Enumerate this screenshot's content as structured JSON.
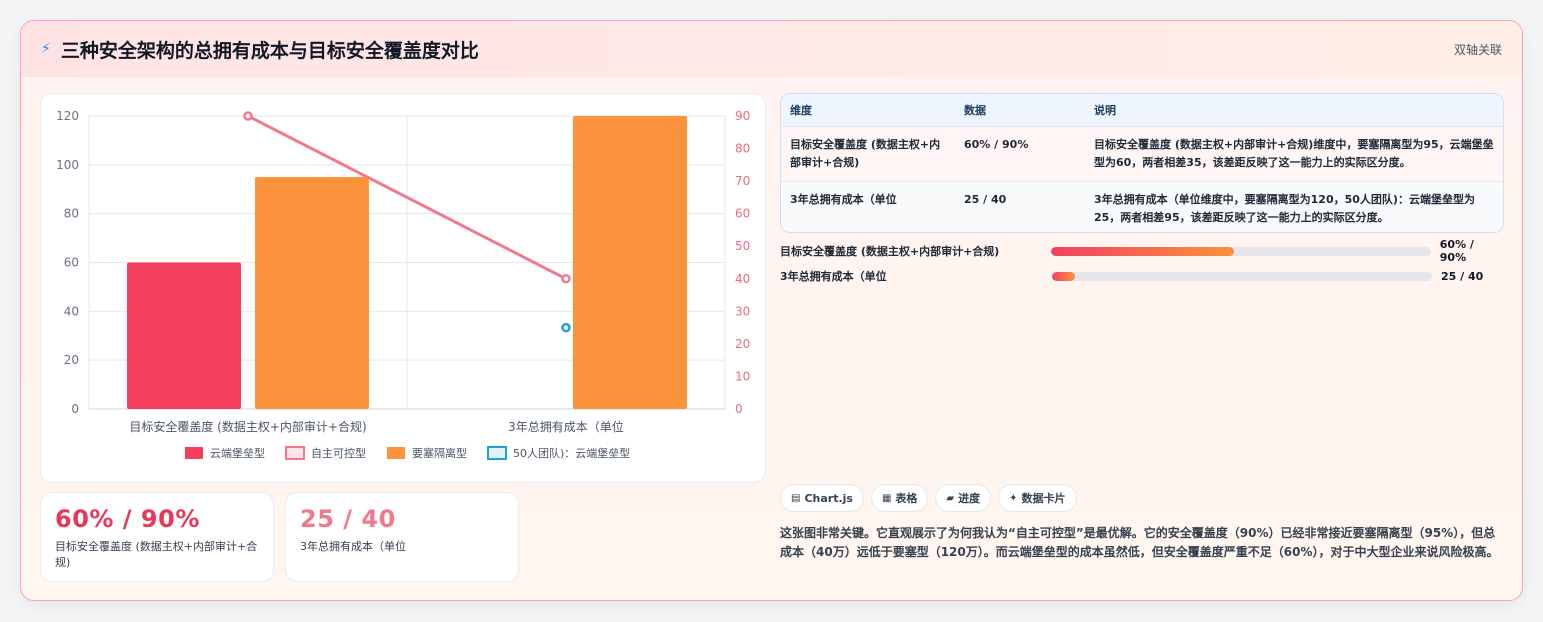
{
  "header": {
    "title": "三种安全架构的总拥有成本与目标安全覆盖度对比",
    "tag": "双轴关联"
  },
  "colors": {
    "red": "#f43f5e",
    "orange": "#fb923c",
    "pink": "#f07a8c",
    "blue": "#1da2d8"
  },
  "chart_data": {
    "type": "bar",
    "categories": [
      "目标安全覆盖度 (数据主权+内部审计+合规)",
      "3年总拥有成本（单位"
    ],
    "series": [
      {
        "name": "云端堡垒型",
        "type": "bar",
        "axis": "left",
        "values": [
          60,
          null
        ],
        "color": "#f43f5e"
      },
      {
        "name": "自主可控型",
        "type": "line",
        "axis": "right",
        "values": [
          90,
          40
        ],
        "color": "#f07a8c"
      },
      {
        "name": "要塞隔离型",
        "type": "bar",
        "axis": "left",
        "values": [
          95,
          120
        ],
        "color": "#fb923c"
      },
      {
        "name": "50人团队)：云端堡垒型",
        "type": "line",
        "axis": "right",
        "values": [
          null,
          25
        ],
        "color": "#1da2d8"
      }
    ],
    "ylim": [
      0,
      120
    ],
    "yticks": [
      0,
      20,
      40,
      60,
      80,
      100,
      120
    ],
    "y2lim": [
      0,
      90
    ],
    "y2ticks": [
      0,
      10,
      20,
      30,
      40,
      50,
      60,
      70,
      80,
      90
    ],
    "grid": true,
    "legend": "bottom"
  },
  "stats": [
    {
      "value": "60% / 90%",
      "label": "目标安全覆盖度 (数据主权+内部审计+合规)",
      "color": "#e8385a"
    },
    {
      "value": "25 / 40",
      "label": "3年总拥有成本（单位",
      "color": "#f07a8c"
    }
  ],
  "table": {
    "headers": [
      "维度",
      "数据",
      "说明"
    ],
    "rows": [
      [
        "目标安全覆盖度 (数据主权+内部审计+合规)",
        "60% / 90%",
        "目标安全覆盖度 (数据主权+内部审计+合规)维度中，要塞隔离型为95，云端堡垒型为60，两者相差35，该差距反映了这一能力上的实际区分度。"
      ],
      [
        "3年总拥有成本（单位",
        "25 / 40",
        "3年总拥有成本（单位维度中，要塞隔离型为120，50人团队)：云端堡垒型为25，两者相差95，该差距反映了这一能力上的实际区分度。"
      ]
    ]
  },
  "progress": [
    {
      "label": "目标安全覆盖度 (数据主权+内部审计+合规)",
      "value_text": "60% / 90%",
      "fraction": 0.48
    },
    {
      "label": "3年总拥有成本（单位",
      "value_text": "25 / 40",
      "fraction": 0.06
    }
  ],
  "chips": [
    {
      "icon": "▤",
      "label": "Chart.js"
    },
    {
      "icon": "▦",
      "label": "表格"
    },
    {
      "icon": "▰",
      "label": "进度"
    },
    {
      "icon": "✦",
      "label": "数据卡片"
    }
  ],
  "description": "这张图非常关键。它直观展示了为何我认为“自主可控型”是最优解。它的安全覆盖度（90%）已经非常接近要塞隔离型（95%），但总成本（40万）远低于要塞型（120万）。而云端堡垒型的成本虽然低，但安全覆盖度严重不足（60%），对于中大型企业来说风险极高。"
}
